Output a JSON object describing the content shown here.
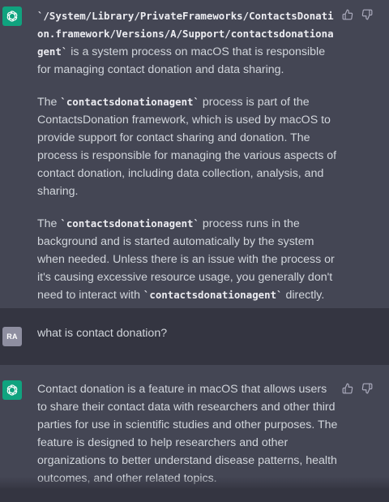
{
  "conversation": [
    {
      "role": "assistant",
      "paragraph1": {
        "code": "`/System/Library/PrivateFrameworks/ContactsDonation.framework/Versions/A/Support/contactsdonationagent`",
        "text": " is a system process on macOS that is responsible for managing contact donation and data sharing."
      },
      "paragraph2": {
        "pre": "The ",
        "code": "`contactsdonationagent`",
        "text": " process is part of the ContactsDonation framework, which is used by macOS to provide support for contact sharing and donation. The process is responsible for managing the various aspects of contact donation, including data collection, analysis, and sharing."
      },
      "paragraph3": {
        "pre": "The ",
        "code": "`contactsdonationagent`",
        "mid": " process runs in the background and is started automatically by the system when needed. Unless there is an issue with the process or it's causing excessive resource usage, you generally don't need to interact with ",
        "code2": "`contactsdonationagent`",
        "post": " directly."
      }
    },
    {
      "role": "user",
      "avatar_initials": "RA",
      "text": "what is contact donation?"
    },
    {
      "role": "assistant",
      "paragraph1": "Contact donation is a feature in macOS that allows users to share their contact data with researchers and other third parties for use in scientific studies and other purposes. The feature is designed to help researchers and other organizations to better understand disease patterns, health outcomes, and other related topics."
    }
  ],
  "icons": {
    "assistant_avatar": "openai-logo-icon",
    "thumbs_up": "thumbs-up-icon",
    "thumbs_down": "thumbs-down-icon"
  },
  "colors": {
    "assistant_bg": "#444654",
    "user_bg": "#343541",
    "gpt_green": "#10a37f",
    "user_avatar_bg": "#8e8ea0"
  }
}
